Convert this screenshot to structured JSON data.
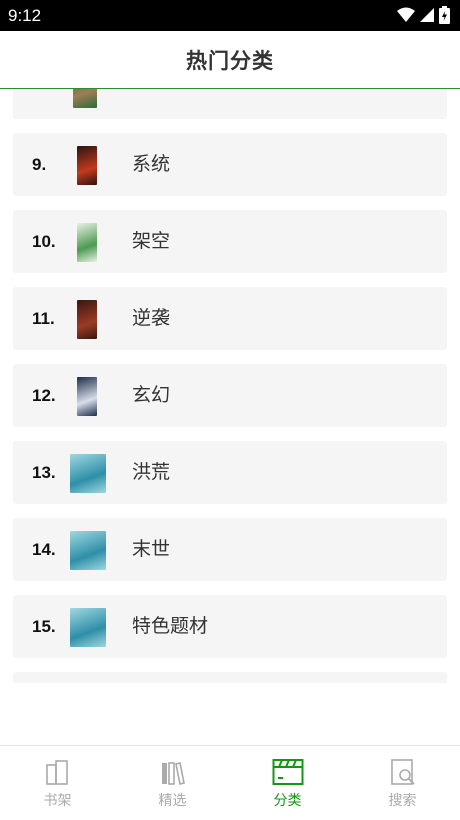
{
  "status_bar": {
    "time": "9:12"
  },
  "header": {
    "title": "热门分类"
  },
  "categories": [
    {
      "rank": "",
      "name": "",
      "cover_colors": [
        "#2d6b3a",
        "#9a7f55"
      ]
    },
    {
      "rank": "9.",
      "name": "系统",
      "cover_colors": [
        "#2a1410",
        "#c23a1e"
      ]
    },
    {
      "rank": "10.",
      "name": "架空",
      "cover_colors": [
        "#e8f1e6",
        "#4d9a52"
      ]
    },
    {
      "rank": "11.",
      "name": "逆袭",
      "cover_colors": [
        "#3a1612",
        "#9b3b24"
      ]
    },
    {
      "rank": "12.",
      "name": "玄幻",
      "cover_colors": [
        "#1b2c4a",
        "#d9dde8"
      ]
    },
    {
      "rank": "13.",
      "name": "洪荒",
      "cover_colors": [
        "#9fd8e0",
        "#2f8fa8"
      ]
    },
    {
      "rank": "14.",
      "name": "末世",
      "cover_colors": [
        "#9fd8e0",
        "#2f8fa8"
      ]
    },
    {
      "rank": "15.",
      "name": "特色题材",
      "cover_colors": [
        "#9fd8e0",
        "#2f8fa8"
      ]
    },
    {
      "rank": "",
      "name": "",
      "cover_colors": [
        "#9fd8e0",
        "#2f8fa8"
      ]
    }
  ],
  "tabs": [
    {
      "label": "书架",
      "icon": "bookshelf-icon",
      "active": false
    },
    {
      "label": "精选",
      "icon": "books-icon",
      "active": false
    },
    {
      "label": "分类",
      "icon": "category-icon",
      "active": true
    },
    {
      "label": "搜索",
      "icon": "search-book-icon",
      "active": false
    }
  ],
  "colors": {
    "accent": "#159615",
    "inactive": "#aaaaaa",
    "row_bg": "#f5f5f5"
  }
}
